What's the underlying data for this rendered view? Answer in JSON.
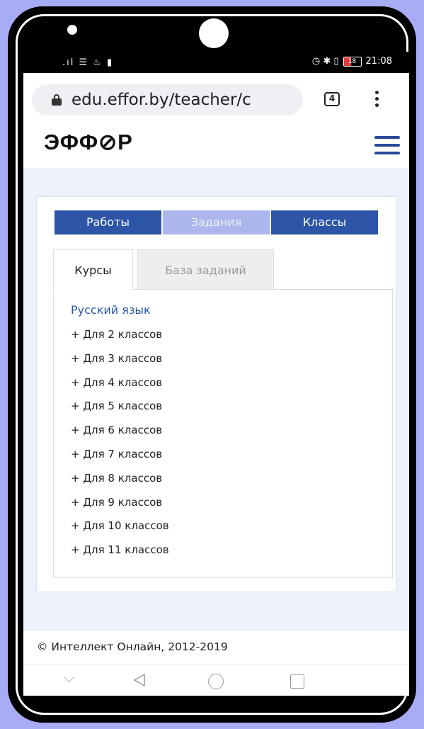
{
  "status_bar": {
    "left_icons": ".ıl ☰ ♨ ▮",
    "right_icons": "◷ ✱ ▯",
    "battery_level": "18",
    "time": "21:08"
  },
  "browser": {
    "url": "edu.effor.by/teacher/c",
    "tab_count": "4"
  },
  "site": {
    "logo": "ЭФФ⊘Р"
  },
  "nav_buttons": {
    "works": "Работы",
    "tasks": "Задания",
    "classes": "Классы"
  },
  "tabs": {
    "courses": "Курсы",
    "task_base": "База заданий"
  },
  "course": {
    "title": "Русский язык",
    "items": [
      "+ Для 2 классов",
      "+ Для 3 классов",
      "+ Для 4 классов",
      "+ Для 5 классов",
      "+ Для 6 классов",
      "+ Для 7 классов",
      "+ Для 8 классов",
      "+ Для 9 классов",
      "+ Для 10 классов",
      "+ Для 11 классов"
    ]
  },
  "footer": {
    "copyright": "© Интеллект Онлайн, 2012-2019"
  },
  "colors": {
    "accent": "#2c55a7",
    "inactive_button": "#aab6ec",
    "page_background": "#edf1fb",
    "backdrop": "#a8acf5"
  }
}
